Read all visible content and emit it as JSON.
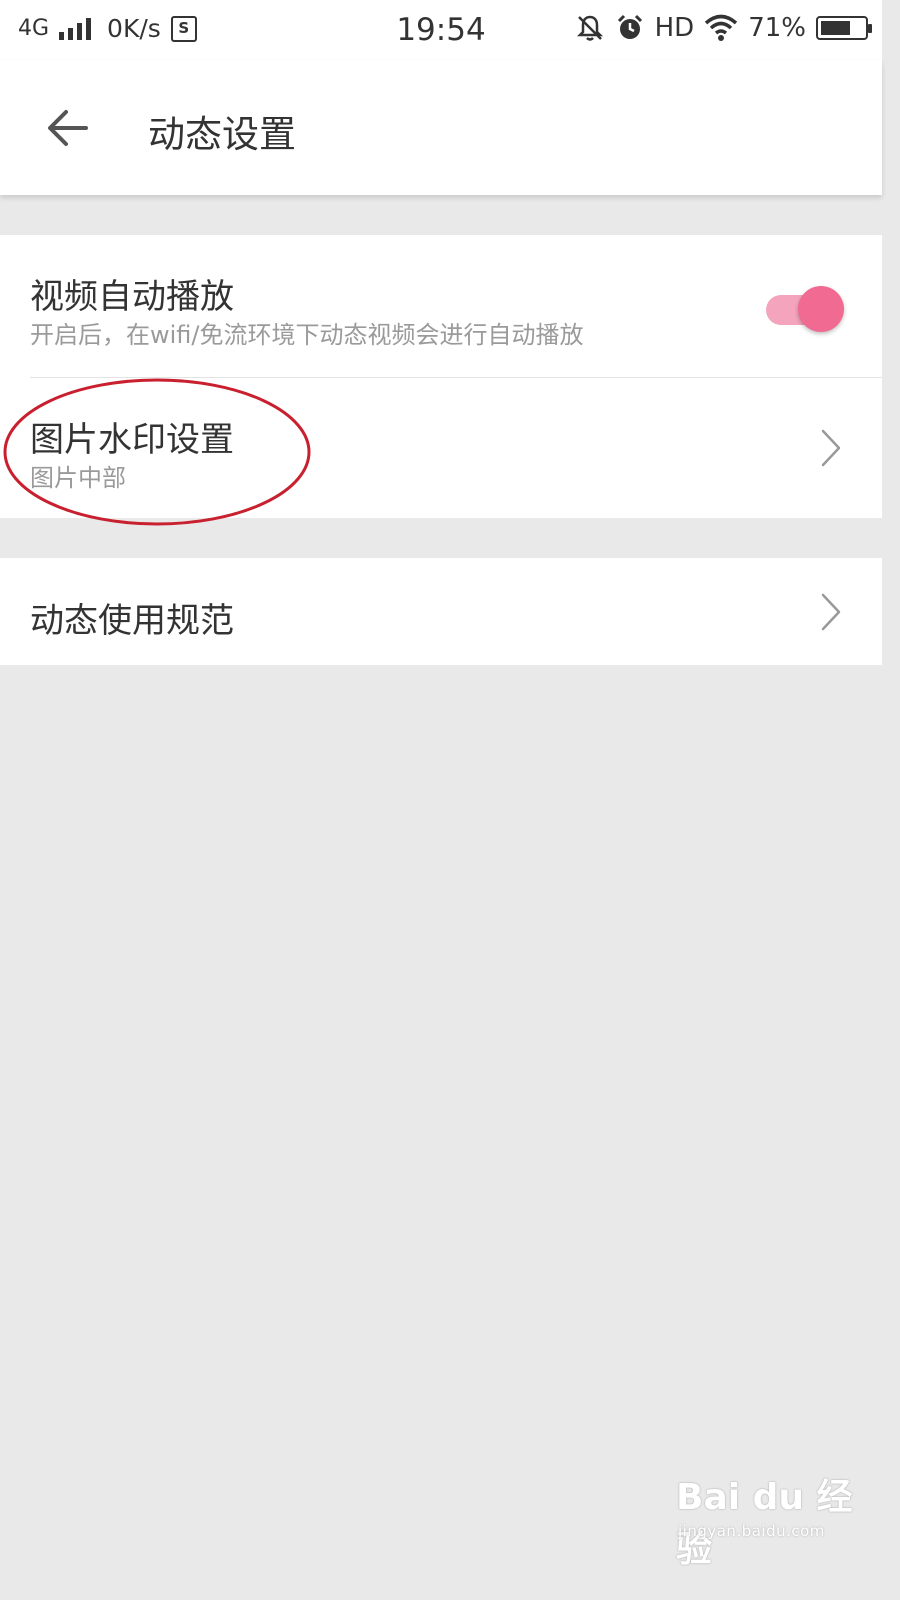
{
  "status_bar": {
    "network": "4G",
    "speed": "0K/s",
    "s_icon": "S",
    "time": "19:54",
    "hd": "HD",
    "battery_percent": "71%",
    "battery_level": 0.71,
    "icons": [
      "signal-icon",
      "sync-s-icon",
      "mute-icon",
      "alarm-icon",
      "wifi-icon",
      "battery-icon"
    ]
  },
  "toolbar": {
    "title": "动态设置",
    "back_icon": "arrow-left-icon"
  },
  "settings": {
    "autoplay": {
      "title": "视频自动播放",
      "subtitle": "开启后，在wifi/免流环境下动态视频会进行自动播放",
      "enabled": true,
      "accent_color": "#f06a92"
    },
    "watermark": {
      "title": "图片水印设置",
      "subtitle": "图片中部",
      "highlight_color": "#c8202e"
    },
    "guidelines": {
      "title": "动态使用规范"
    }
  },
  "baidu_watermark": {
    "logo": "Bai du 经验",
    "url": "jingyan.baidu.com"
  }
}
